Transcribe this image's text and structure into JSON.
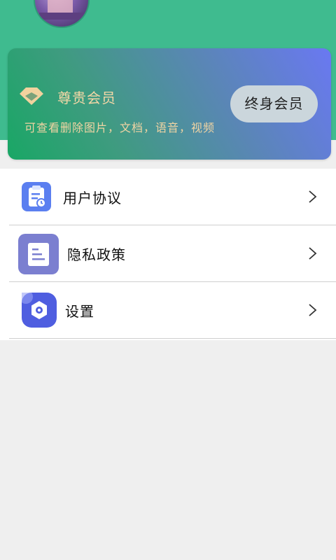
{
  "vip": {
    "title": "尊贵会员",
    "description": "可查看删除图片，文档，语音，视频",
    "button_label": "终身会员"
  },
  "menu": {
    "items": [
      {
        "label": "用户协议",
        "icon": "clipboard-icon"
      },
      {
        "label": "隐私政策",
        "icon": "document-icon"
      },
      {
        "label": "设置",
        "icon": "settings-icon"
      }
    ]
  },
  "colors": {
    "header": "#3fbb8f",
    "card_gradient_start": "#19a765",
    "card_gradient_end": "#6a78f2",
    "gold_text": "#f0d4a3",
    "page_bg": "#efefef"
  }
}
